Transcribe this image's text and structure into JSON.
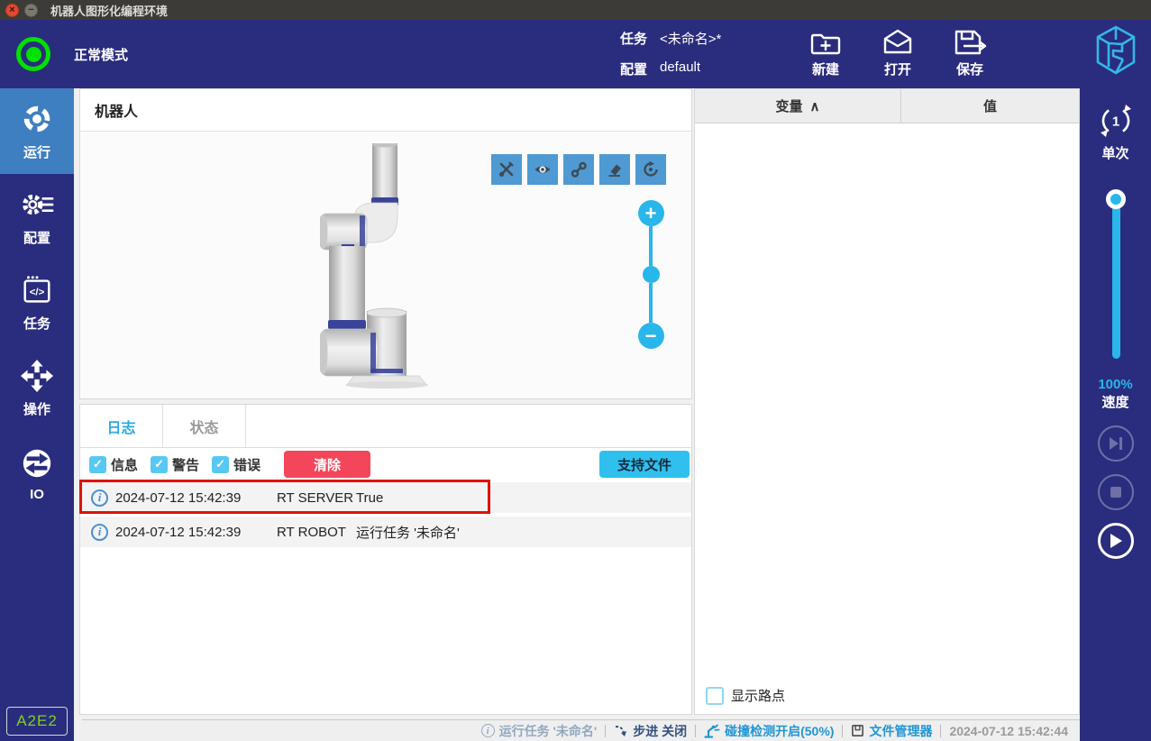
{
  "titlebar": {
    "title": "机器人图形化编程环境",
    "close_glyph": "×",
    "minimize_glyph": "−"
  },
  "header": {
    "mode_label": "正常模式",
    "task_label": "任务",
    "task_value": "<未命名>*",
    "config_label": "配置",
    "config_value": "default",
    "new_label": "新建",
    "open_label": "打开",
    "save_label": "保存"
  },
  "sidebar": {
    "items": [
      {
        "label": "运行",
        "icon": "run-target-icon",
        "active": true
      },
      {
        "label": "配置",
        "icon": "gear-icon",
        "active": false
      },
      {
        "label": "任务",
        "icon": "code-window-icon",
        "active": false
      },
      {
        "label": "操作",
        "icon": "move-arrows-icon",
        "active": false
      },
      {
        "label": "IO",
        "icon": "io-exchange-icon",
        "active": false
      }
    ],
    "badge": "A2E2"
  },
  "robot_panel": {
    "title": "机器人",
    "toolbar_icons": [
      "tools-icon",
      "visibility-eye-icon",
      "path-spline-icon",
      "eraser-icon",
      "reset-view-icon"
    ],
    "zoom_in_glyph": "+",
    "zoom_out_glyph": "−"
  },
  "log_panel": {
    "tabs": [
      {
        "label": "日志",
        "active": true
      },
      {
        "label": "状态",
        "active": false
      }
    ],
    "filters": [
      {
        "label": "信息",
        "checked": true
      },
      {
        "label": "警告",
        "checked": true
      },
      {
        "label": "错误",
        "checked": true
      }
    ],
    "check_glyph": "✓",
    "clear_label": "清除",
    "support_label": "支持文件",
    "entries": [
      {
        "time": "2024-07-12 15:42:39",
        "source": "RT SERVER",
        "message": "True",
        "highlighted": true
      },
      {
        "time": "2024-07-12 15:42:39",
        "source": "RT ROBOT",
        "message": "运行任务 '未命名'",
        "highlighted": false
      }
    ]
  },
  "variables_panel": {
    "var_column": "变量",
    "sort_caret": "∧",
    "value_column": "值",
    "show_waypoints_label": "显示路点",
    "show_waypoints_checked": false
  },
  "run_controls": {
    "loop_count": "1",
    "loop_label": "单次",
    "speed_value": "100%",
    "speed_label": "速度"
  },
  "statusbar": {
    "running_task": "运行任务 '未命名'",
    "step_label": "步进 关闭",
    "collision_label": "碰撞检测开启(50%)",
    "file_manager_label": "文件管理器",
    "timestamp": "2024-07-12 15:42:44",
    "info_glyph": "i"
  },
  "colors": {
    "navy": "#2a2d7d",
    "accent_blue": "#29abe2",
    "control_blue": "#29b6ea",
    "active_nav": "#3e7fc1",
    "danger_red": "#f4465a",
    "highlight_red": "#e01307",
    "ok_green": "#00e100",
    "badge_green": "#7ed321",
    "toolbar_blue": "#4f9ad2"
  }
}
